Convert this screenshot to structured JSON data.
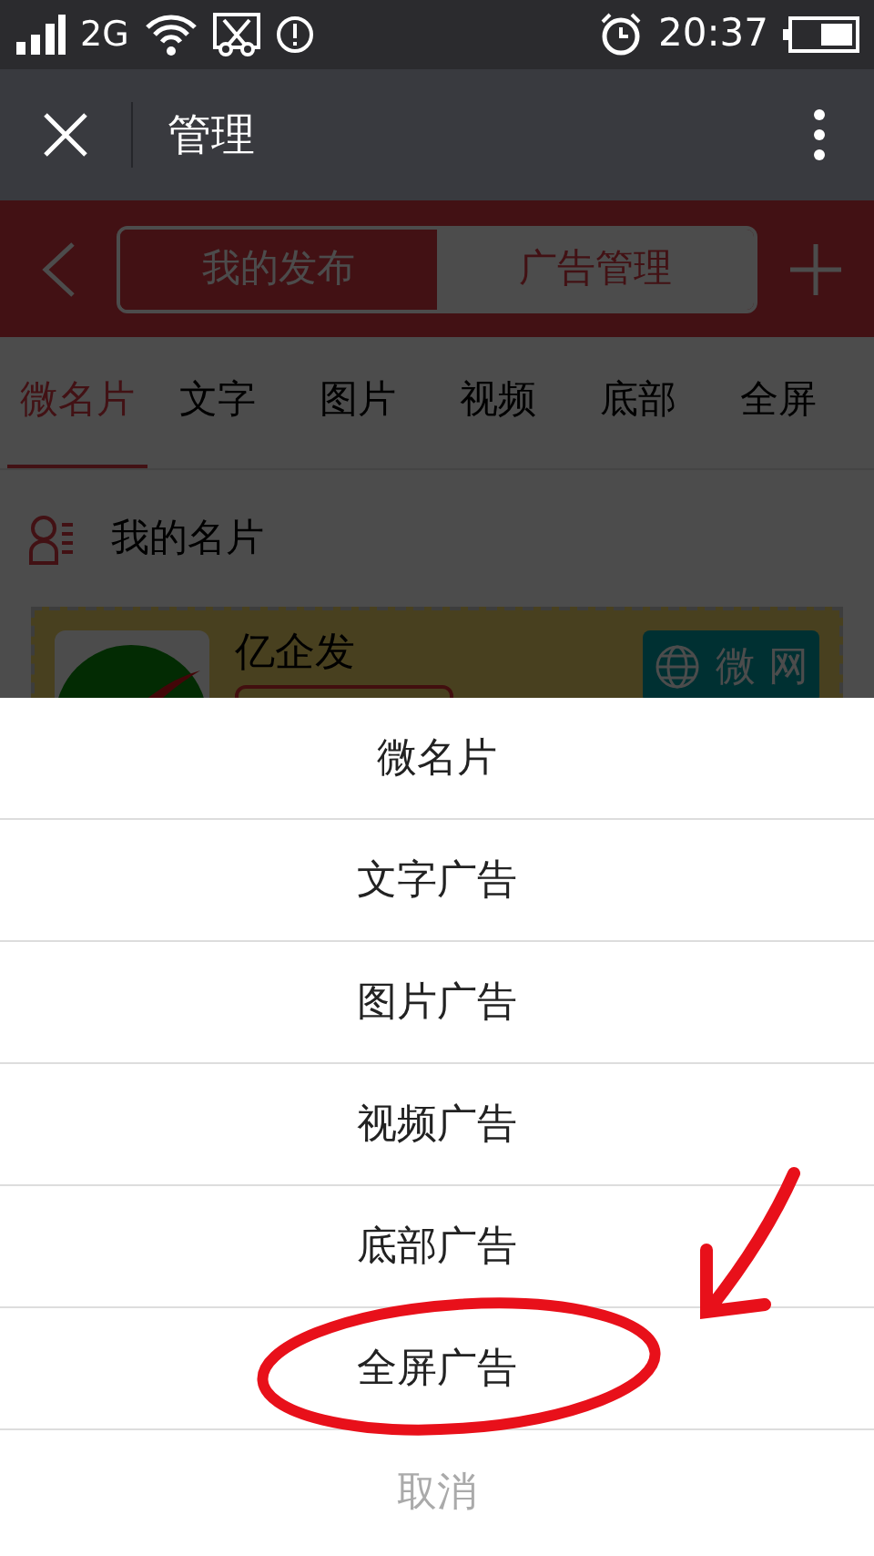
{
  "status_bar": {
    "network": "2G",
    "time": "20:37"
  },
  "title_bar": {
    "title": "管理"
  },
  "header": {
    "segments": [
      {
        "label": "我的发布",
        "selected": false
      },
      {
        "label": "广告管理",
        "selected": true
      }
    ]
  },
  "category_tabs": [
    {
      "label": "微名片",
      "selected": true
    },
    {
      "label": "文字",
      "selected": false
    },
    {
      "label": "图片",
      "selected": false
    },
    {
      "label": "视频",
      "selected": false
    },
    {
      "label": "底部",
      "selected": false
    },
    {
      "label": "全屏",
      "selected": false
    }
  ],
  "section": {
    "title": "我的名片"
  },
  "card": {
    "name": "亿企发",
    "badge": "微 网"
  },
  "action_sheet": {
    "options": [
      {
        "label": "微名片",
        "highlighted": false
      },
      {
        "label": "文字广告",
        "highlighted": false
      },
      {
        "label": "图片广告",
        "highlighted": false
      },
      {
        "label": "视频广告",
        "highlighted": false
      },
      {
        "label": "底部广告",
        "highlighted": false
      },
      {
        "label": "全屏广告",
        "highlighted": true
      }
    ],
    "cancel": "取消"
  }
}
